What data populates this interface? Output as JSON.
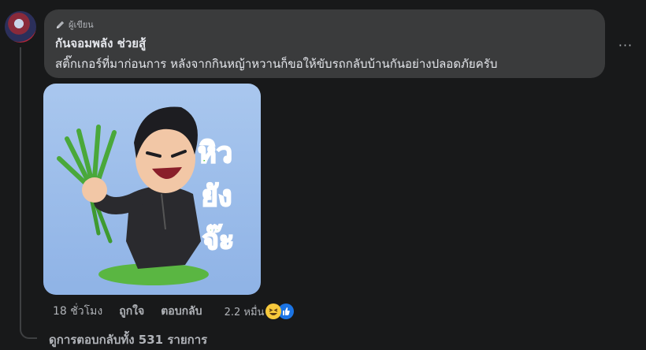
{
  "comment": {
    "badge": "ผู้เขียน",
    "author": "กันจอมพลัง ช่วยสู้",
    "text": "สติ๊กเกอร์ที่มาก่อนการ หลังจากกินหญ้าหวานก็ขอให้ขับรถกลับบ้านกันอย่างปลอดภัยครับ",
    "more_label": "···"
  },
  "sticker": {
    "caption_lines": [
      "หิว",
      "ยัง",
      "จ๊ะ"
    ],
    "colors": {
      "background": "#9bbcec",
      "text": "#4ac73a",
      "suit": "#2a2a2e",
      "grass": "#5ab642"
    }
  },
  "actions": {
    "time": "18 ชั่วโมง",
    "like": "ถูกใจ",
    "reply": "ตอบกลับ",
    "reaction_count": "2.2 หมื่น",
    "reaction_icons": [
      "haha-icon",
      "like-icon"
    ]
  },
  "view_replies": "ดูการตอบกลับทั้ง 531 รายการ"
}
